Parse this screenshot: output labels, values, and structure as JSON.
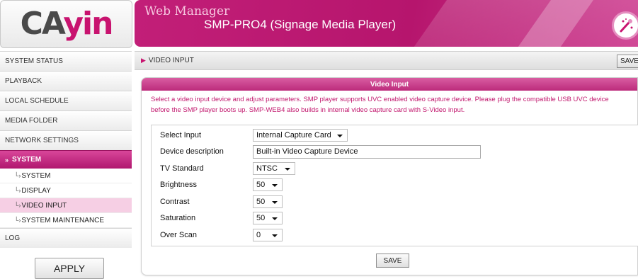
{
  "logo": {
    "part1": "CA",
    "part2": "yin",
    "icon": "cayin-logo"
  },
  "header": {
    "title": "Web Manager",
    "subtitle": "SMP-PRO4 (Signage Media Player)",
    "wizard_icon": "wizard-wand-icon",
    "accent_color": "#c2186e"
  },
  "sidebar": {
    "items": [
      {
        "label": "SYSTEM STATUS"
      },
      {
        "label": "PLAYBACK"
      },
      {
        "label": "LOCAL SCHEDULE"
      },
      {
        "label": "MEDIA FOLDER"
      },
      {
        "label": "NETWORK SETTINGS"
      },
      {
        "label": "SYSTEM",
        "active": true,
        "arrow": "»"
      },
      {
        "label": "LOG"
      }
    ],
    "subitems": [
      {
        "tick": "└›",
        "label": "SYSTEM"
      },
      {
        "tick": "└›",
        "label": "DISPLAY"
      },
      {
        "tick": "└›",
        "label": "VIDEO INPUT",
        "active": true
      },
      {
        "tick": "└›",
        "label": "SYSTEM MAINTENANCE"
      }
    ],
    "apply_label": "APPLY"
  },
  "breadcrumb": {
    "arrow": "▶",
    "text": "VIDEO INPUT",
    "save_label": "SAVE"
  },
  "panel": {
    "title": "Video Input",
    "description": "Select a video input device and adjust parameters. SMP player supports UVC enabled video capture device. Please plug the compatible USB UVC device before the SMP player boots up. SMP-WEB4 also builds in internal video capture card with S-Video input.",
    "fields": {
      "select_input": {
        "label": "Select Input",
        "value": "Internal Capture Card"
      },
      "device_description": {
        "label": "Device description",
        "value": "Built-in Video Capture Device"
      },
      "tv_standard": {
        "label": "TV Standard",
        "value": "NTSC"
      },
      "brightness": {
        "label": "Brightness",
        "value": "50"
      },
      "contrast": {
        "label": "Contrast",
        "value": "50"
      },
      "saturation": {
        "label": "Saturation",
        "value": "50"
      },
      "over_scan": {
        "label": "Over Scan",
        "value": "0"
      }
    },
    "save_label": "SAVE"
  }
}
